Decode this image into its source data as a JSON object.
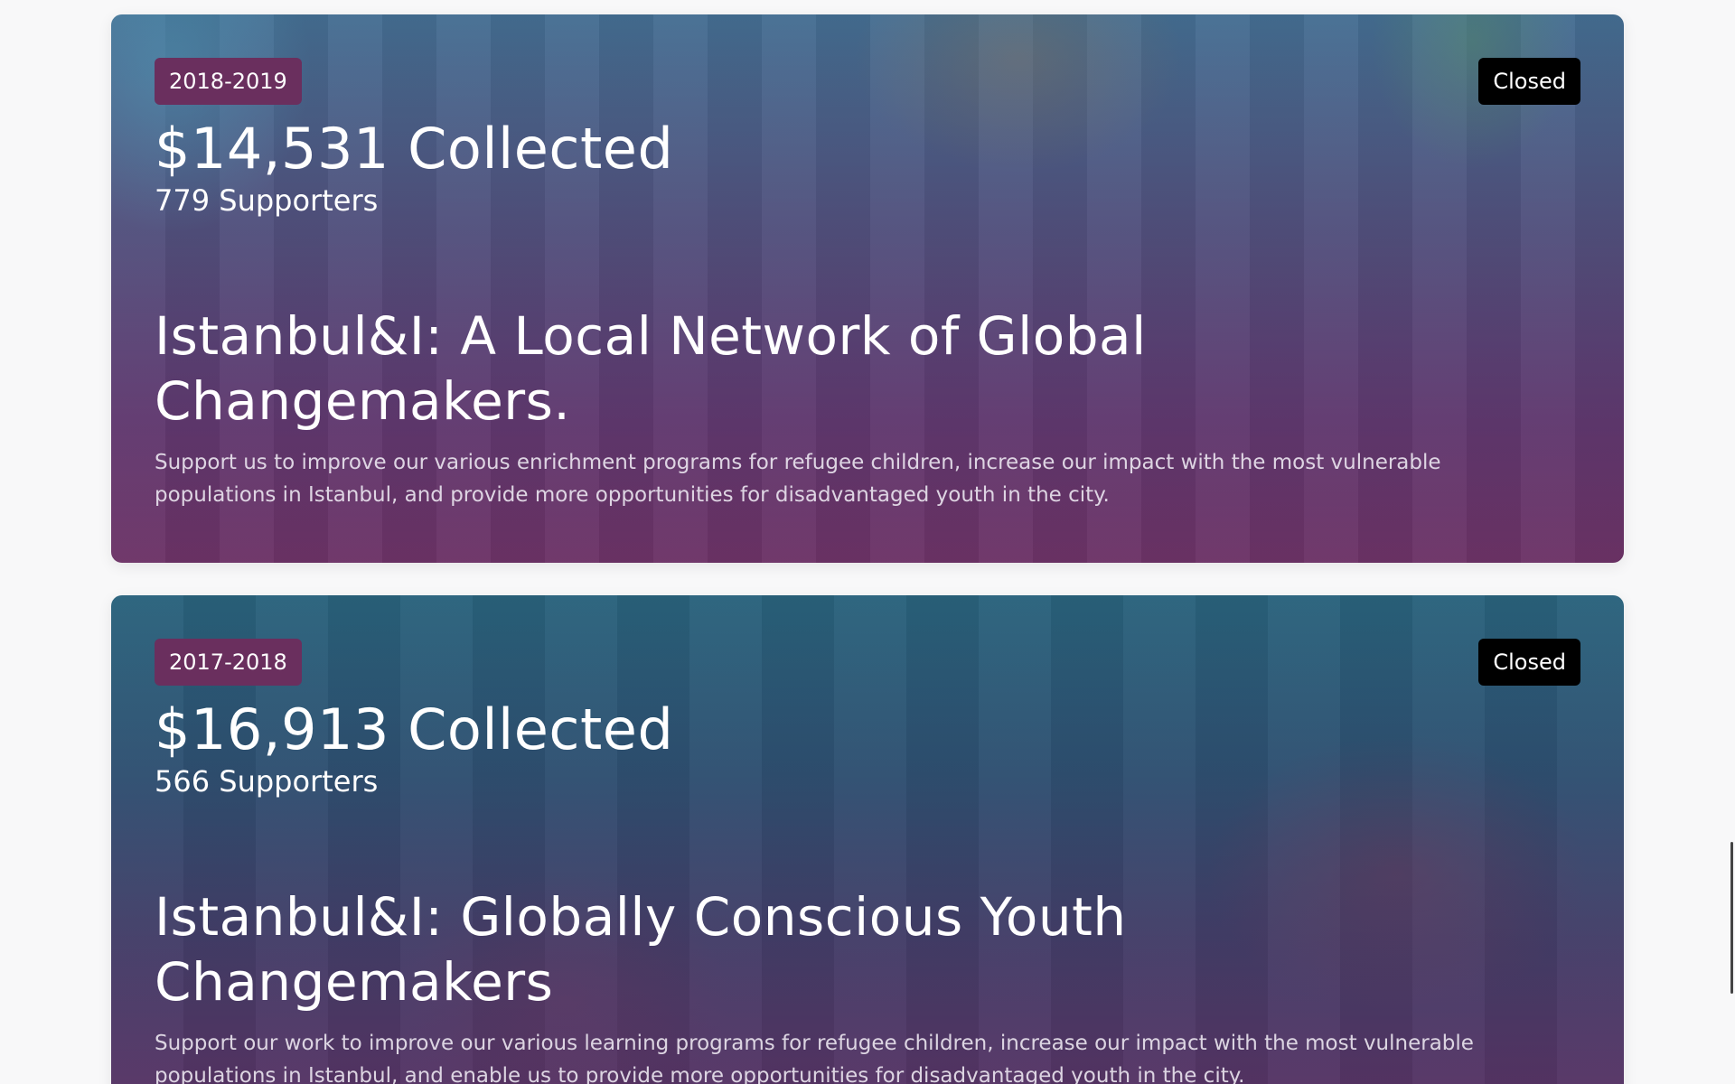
{
  "campaigns": [
    {
      "year": "2018-2019",
      "status": "Closed",
      "amount": "$14,531 Collected",
      "supporters": "779 Supporters",
      "title": "Istanbul&I: A Local Network of Global Changemakers.",
      "description": "Support us to improve our various enrichment programs for refugee children, increase our impact with the most vulnerable populations in Istanbul, and provide more opportunities for disadvantaged youth in the city."
    },
    {
      "year": "2017-2018",
      "status": "Closed",
      "amount": "$16,913 Collected",
      "supporters": "566 Supporters",
      "title": "Istanbul&I: Globally Conscious Youth Changemakers",
      "description": "Support our work to improve our various learning programs for refugee children, increase our impact with the most vulnerable populations in Istanbul, and enable us to provide more opportunities for disadvantaged youth in the city."
    }
  ],
  "colors": {
    "year_badge_bg": "#6a2f5e",
    "status_badge_bg": "#000000",
    "page_bg": "#f8f8f9"
  }
}
